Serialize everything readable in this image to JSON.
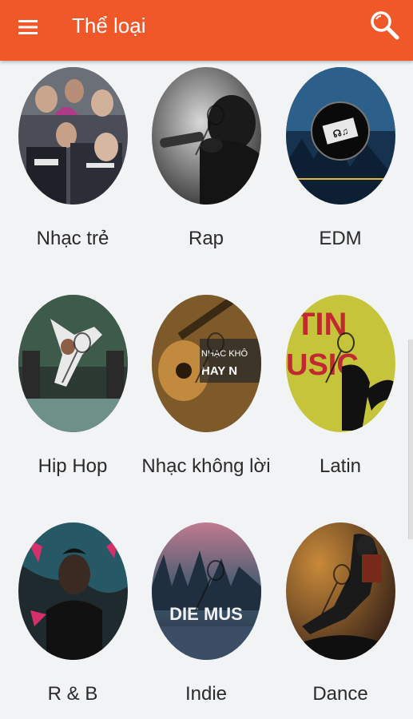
{
  "appbar": {
    "title": "Thể loại",
    "menu_icon": "menu-icon",
    "search_icon": "search-icon",
    "color": "#f0582a"
  },
  "genres": [
    {
      "label": "Nhạc trẻ"
    },
    {
      "label": "Rap"
    },
    {
      "label": "EDM"
    },
    {
      "label": "Hip Hop"
    },
    {
      "label": "Nhạc không lời"
    },
    {
      "label": "Latin"
    },
    {
      "label": "R & B"
    },
    {
      "label": "Indie"
    },
    {
      "label": "Dance"
    }
  ],
  "thumb_text": {
    "nhac_khong_loi": "NHẠC KHÔ",
    "nhac_khong_loi_2": "HAY N",
    "latin_1": "TIN",
    "latin_2": "USIC",
    "indie": "DIE MUS"
  }
}
